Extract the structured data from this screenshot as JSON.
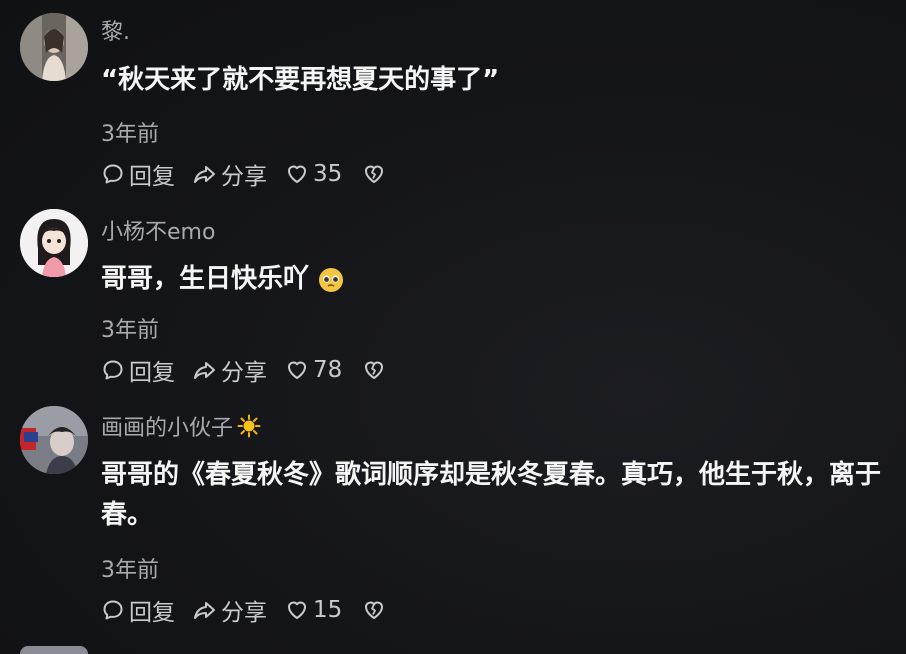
{
  "comments": [
    {
      "username": "黎.",
      "text": "“秋天来了就不要再想夏天的事了”",
      "time": "3年前",
      "reply_label": "回复",
      "share_label": "分享",
      "like_count": "35"
    },
    {
      "username": "小杨不emo",
      "text": "哥哥，生日快乐吖",
      "time": "3年前",
      "reply_label": "回复",
      "share_label": "分享",
      "like_count": "78"
    },
    {
      "username": "画画的小伙子",
      "text": "哥哥的《春夏秋冬》歌词顺序却是秋冬夏春。真巧，他生于秋，离于春。",
      "time": "3年前",
      "reply_label": "回复",
      "share_label": "分享",
      "like_count": "15"
    }
  ],
  "icons": {
    "reply": "comment-bubble-icon",
    "share": "share-arrow-icon",
    "like": "heart-icon",
    "dislike": "broken-heart-icon",
    "sun": "sun-emoji-icon",
    "pleading": "pleading-face-emoji-icon"
  },
  "colors": {
    "background": "#141518",
    "primary_text": "#f5f5f5",
    "secondary_text": "#a9aab0"
  }
}
